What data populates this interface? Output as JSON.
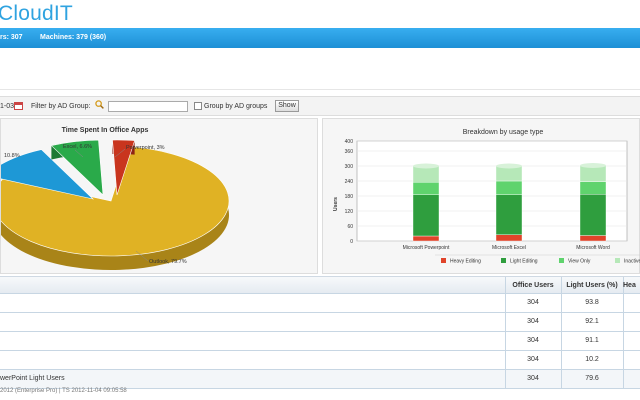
{
  "app": {
    "brand": "CloudIT"
  },
  "status": {
    "users": "rs: 307",
    "machines": "Machines: 379 (360)"
  },
  "filter": {
    "date": "1-03",
    "label": "Filter by AD Group:",
    "input_value": "",
    "group_label": "Group by AD groups",
    "show_label": "Show"
  },
  "pie": {
    "title": "Time Spent In Office Apps",
    "labels": {
      "excel": "Excel, 6.6%",
      "powerpoint": "Powerpoint, 3%",
      "word": "10.8%",
      "outlook": "Outlook, 79.7%"
    },
    "chart_data": {
      "type": "pie",
      "values": [
        79.7,
        10.8,
        6.6,
        3.0
      ],
      "categories": [
        "Outlook",
        "",
        "Excel",
        "Powerpoint"
      ],
      "colors": [
        "#e0b224",
        "#1e98d6",
        "#2aaa4a",
        "#c9351e"
      ]
    }
  },
  "bars": {
    "title": "Breakdown by usage type",
    "ylabel": "Users",
    "chart_data": {
      "type": "bar",
      "categories": [
        "Microsoft Powerpoint",
        "Microsoft Excel",
        "Microsoft Word"
      ],
      "ylim": [
        0,
        400
      ],
      "yticks": [
        "0",
        "60",
        "120",
        "180",
        "240",
        "300",
        "360",
        "400"
      ],
      "series": [
        {
          "name": "Heavy Editing",
          "values": [
            20,
            25,
            22
          ],
          "color": "#e0442a"
        },
        {
          "name": "Light Editing",
          "values": [
            165,
            160,
            165
          ],
          "color": "#2f9e3e"
        },
        {
          "name": "View Only",
          "values": [
            50,
            55,
            50
          ],
          "color": "#5fd36d"
        },
        {
          "name": "Inactive",
          "values": [
            65,
            60,
            65
          ],
          "color": "#b6e8b8"
        }
      ],
      "legend": [
        "Heavy Editing",
        "Light Editing",
        "View Only",
        "Inactive"
      ]
    }
  },
  "table": {
    "headers": [
      "",
      "Office Users",
      "Light Users (%)",
      "Hea"
    ],
    "rows": [
      {
        "name": "",
        "office": "304",
        "light": "93.8"
      },
      {
        "name": "",
        "office": "304",
        "light": "92.1"
      },
      {
        "name": "",
        "office": "304",
        "light": "91.1"
      },
      {
        "name": "",
        "office": "304",
        "light": "10.2"
      },
      {
        "name": "werPoint Light Users",
        "office": "304",
        "light": "79.6"
      }
    ]
  },
  "footer": {
    "text": "2012 (Enterprise Pro)  |  TS 2012-11-04 09:05:58"
  }
}
